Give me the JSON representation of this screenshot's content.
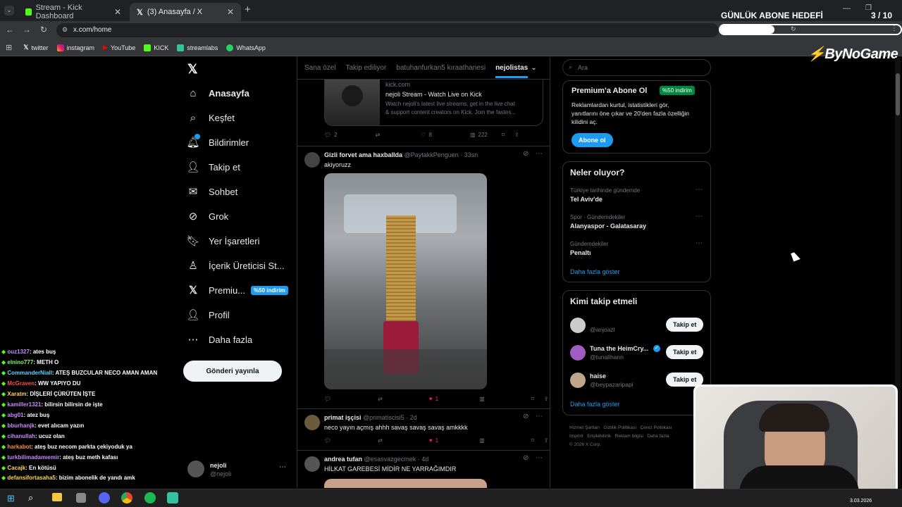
{
  "browser": {
    "tabs": [
      {
        "label": "Stream - Kick Dashboard"
      },
      {
        "label": "(3) Anasayfa / X"
      }
    ],
    "url": "x.com/home",
    "bookmarks": [
      {
        "label": "twitter"
      },
      {
        "label": "instagram"
      },
      {
        "label": "YouTube"
      },
      {
        "label": "KICK"
      },
      {
        "label": "streamlabs"
      },
      {
        "label": "WhatsApp"
      }
    ]
  },
  "overlay": {
    "goal_title": "GÜNLÜK ABONE HEDEFİ",
    "goal_count": "3 / 10",
    "goal_progress": 0.3,
    "brand": "ByNoGame"
  },
  "nav": {
    "items": [
      {
        "label": "Anasayfa"
      },
      {
        "label": "Keşfet"
      },
      {
        "label": "Bildirimler"
      },
      {
        "label": "Takip et"
      },
      {
        "label": "Sohbet"
      },
      {
        "label": "Grok"
      },
      {
        "label": "Yer İşaretleri"
      },
      {
        "label": "İçerik Üreticisi St..."
      },
      {
        "label": "Premiu..."
      },
      {
        "label": "Profil"
      },
      {
        "label": "Daha fazla"
      }
    ],
    "premium_badge": "%50 indirim",
    "post_button": "Gönderi yayınla",
    "account": {
      "name": "nejoli",
      "handle": "@nejoli"
    }
  },
  "feed": {
    "tabs": [
      "Sana özel",
      "Takip ediliyor",
      "batuhanfurkan5 kıraathanesi",
      "nejolistas"
    ],
    "link_card": {
      "domain": "kick.com",
      "title": "nejoli Stream - Watch Live on Kick",
      "desc1": "Watch nejoli's latest live streams, get in the live chat",
      "desc2": "& support content creators on Kick. Join the fastes..."
    },
    "post0_stats": {
      "replies": "2",
      "likes": "8",
      "views": "222"
    },
    "posts": [
      {
        "name": "Gizli forvet ama haxballda",
        "handle": "@PaytakkPenguen · 33sn",
        "text": "akiyoruzz",
        "likes": "1"
      },
      {
        "name": "primat işçisi",
        "handle": "@primatiscisi5 · 2d",
        "text": "neco yayın açmış ahhh savaş savaş savaş amkkkk",
        "likes": "1"
      },
      {
        "name": "andrea tufan",
        "handle": "@esasvazgecmek · 4d",
        "text": "HİLKAT GAREBESİ MİDİR NE YARRAĞIMDIR"
      }
    ]
  },
  "sidebar": {
    "search_placeholder": "Ara",
    "premium": {
      "title": "Premium'a Abone Ol",
      "badge": "%50 indirim",
      "body1": "Reklamlardan kurtul, istatistikleri gör,",
      "body2": "yanıtlarını öne çıkar ve 20'den fazla özelliğin",
      "body3": "kilidini aç.",
      "button": "Abone ol"
    },
    "trends": {
      "title": "Neler oluyor?",
      "items": [
        {
          "context": "Türkiye tarihinde gündemde",
          "name": "Tel Aviv'de"
        },
        {
          "context": "Spor · Gündemdekiler",
          "name": "Alanyaspor - Galatasaray"
        },
        {
          "context": "Gündemdekiler",
          "name": "Penaltı"
        }
      ],
      "more": "Daha fazla göster"
    },
    "who": {
      "title": "Kimi takip etmeli",
      "items": [
        {
          "name": "",
          "handle": "@anjoazl"
        },
        {
          "name": "Tuna the HeimCry...",
          "handle": "@tunalihann"
        },
        {
          "name": "haise",
          "handle": "@beypazaripapi"
        }
      ],
      "follow": "Takip et",
      "more": "Daha fazla göster"
    },
    "footer": {
      "l1": [
        "Hizmet Şartları",
        "Gizlilik Politikası",
        "Çerez Politikası"
      ],
      "l2": [
        "Imprint",
        "Erişilebilirlik",
        "Reklam bilgisi",
        "Daha fazla"
      ],
      "copy": "© 2026 X Corp."
    }
  },
  "chat": [
    {
      "user": "ouz1327",
      "msg": ": ates buş",
      "color": "#c78bff"
    },
    {
      "user": "elnino777",
      "msg": ": METH O",
      "color": "#7cff6b"
    },
    {
      "user": "CommanderNiall",
      "msg": ": ATEŞ BUZCULAR NECO AMAN AMAN",
      "color": "#5fd4ff"
    },
    {
      "user": "McGraven",
      "msg": ": WW YAPIYO DU",
      "color": "#ff4d4d"
    },
    {
      "user": "Xaratm",
      "msg": ": DİŞLERİ ÇÜRÜTEN İŞTE",
      "color": "#ffd84d"
    },
    {
      "user": "kamiller1321",
      "msg": ": bilirsin bilirsin de işte",
      "color": "#c78bff"
    },
    {
      "user": "abg01",
      "msg": ": atez buş",
      "color": "#c78bff"
    },
    {
      "user": "bburhanjk",
      "msg": ": evet alıcam yazın",
      "color": "#c78bff"
    },
    {
      "user": "cihanullah",
      "msg": ": ucuz olan",
      "color": "#c78bff"
    },
    {
      "user": "harkabot",
      "msg": ": ateş buz necom parkta çekiyoduk ya",
      "color": "#ff8a4d"
    },
    {
      "user": "turkbilimadamıemir",
      "msg": ": ateş buz meth kafası",
      "color": "#c78bff"
    },
    {
      "user": "Cacajk",
      "msg": ": En kötüsü",
      "color": "#ffd84d"
    },
    {
      "user": "defansifortasaha5",
      "msg": ": bizim abonelik de yandı amk",
      "color": "#ffd84d"
    }
  ],
  "taskbar": {
    "date": "3.03.2026"
  }
}
